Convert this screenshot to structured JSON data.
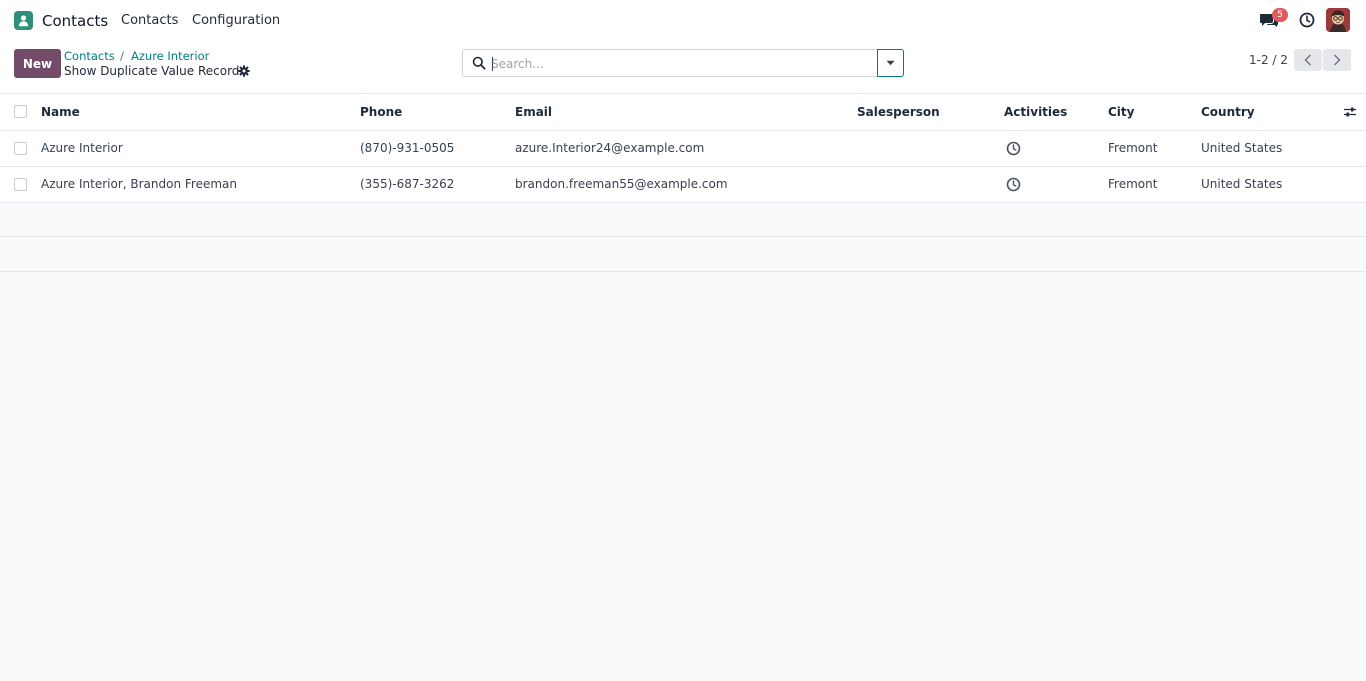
{
  "navbar": {
    "app_name": "Contacts",
    "menu": [
      "Contacts",
      "Configuration"
    ],
    "messages_badge": "5"
  },
  "control": {
    "new_label": "New",
    "breadcrumb": [
      "Contacts",
      "Azure Interior"
    ],
    "subtitle": "Show Duplicate Value Record",
    "search_placeholder": "Search...",
    "pager": "1-2 / 2"
  },
  "table": {
    "headers": {
      "name": "Name",
      "phone": "Phone",
      "email": "Email",
      "salesperson": "Salesperson",
      "activities": "Activities",
      "city": "City",
      "country": "Country"
    },
    "rows": [
      {
        "name": "Azure Interior",
        "phone": "(870)-931-0505",
        "email": "azure.Interior24@example.com",
        "salesperson": "",
        "city": "Fremont",
        "country": "United States"
      },
      {
        "name": "Azure Interior, Brandon Freeman",
        "phone": "(355)-687-3262",
        "email": "brandon.freeman55@example.com",
        "salesperson": "",
        "city": "Fremont",
        "country": "United States"
      }
    ]
  },
  "colors": {
    "brand": "#714b67",
    "link": "#017e84",
    "badge": "#e35a5a"
  }
}
